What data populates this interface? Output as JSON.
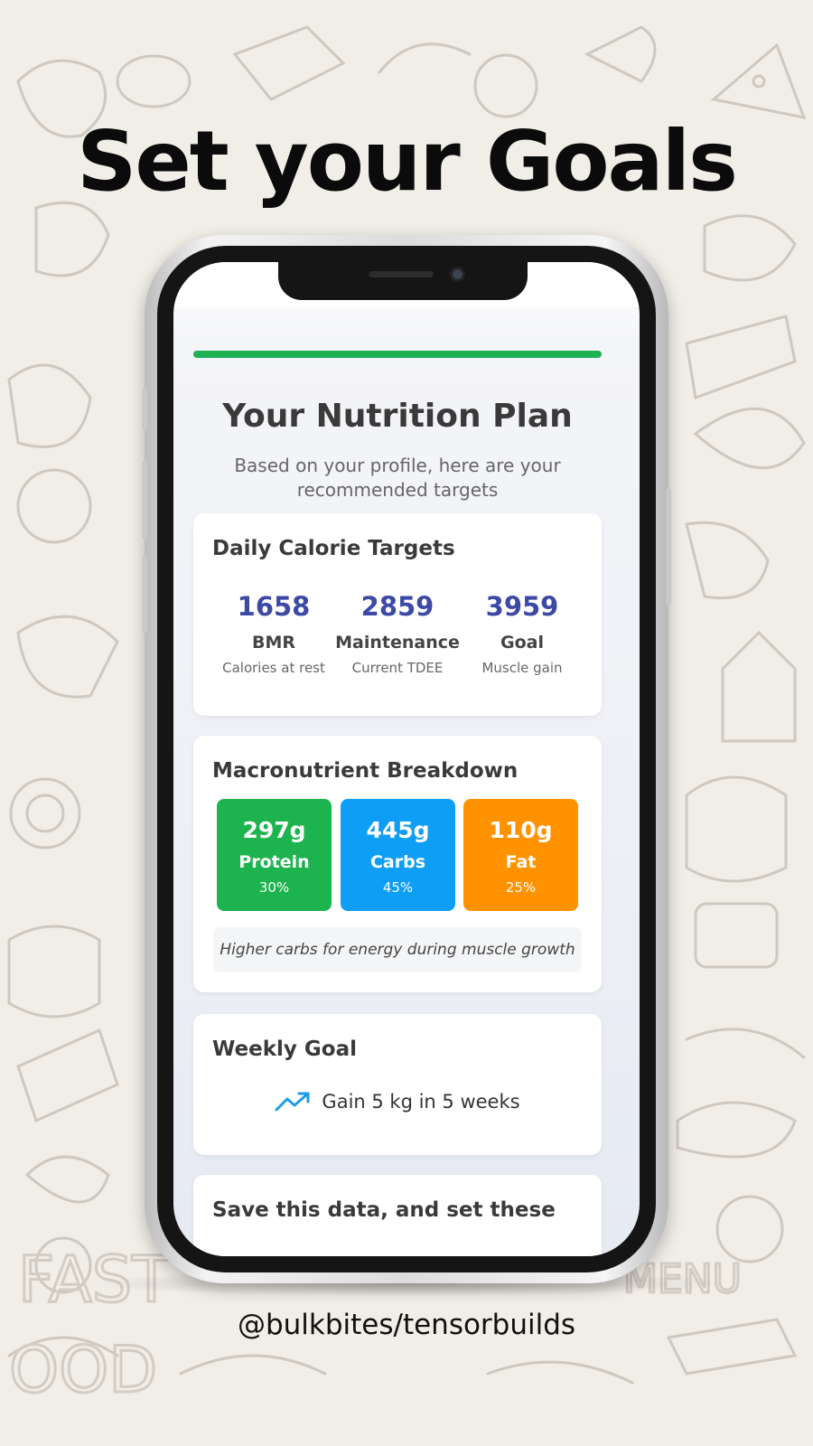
{
  "headline": "Set your Goals",
  "handle": "@bulkbites/tensorbuilds",
  "colors": {
    "background": "#f1ede7",
    "progress": "#1fb254",
    "calorie_value": "#3d4aa5",
    "protein": "#1db34e",
    "carbs": "#0f9ef5",
    "fat": "#ff9200"
  },
  "app": {
    "progress_fraction": 1.0,
    "title": "Your Nutrition Plan",
    "subtitle": "Based on your profile, here are your recommended targets",
    "calorie_card": {
      "title": "Daily Calorie Targets",
      "items": [
        {
          "value": "1658",
          "label": "BMR",
          "note": "Calories at rest"
        },
        {
          "value": "2859",
          "label": "Maintenance",
          "note": "Current TDEE"
        },
        {
          "value": "3959",
          "label": "Goal",
          "note": "Muscle gain"
        }
      ]
    },
    "macro_card": {
      "title": "Macronutrient Breakdown",
      "items": [
        {
          "grams": "297g",
          "name": "Protein",
          "percent": "30%"
        },
        {
          "grams": "445g",
          "name": "Carbs",
          "percent": "45%"
        },
        {
          "grams": "110g",
          "name": "Fat",
          "percent": "25%"
        }
      ],
      "note": "Higher carbs for energy during muscle growth"
    },
    "weekly_card": {
      "title": "Weekly Goal",
      "icon": "trending-up-icon",
      "text": "Gain 5 kg in 5 weeks"
    },
    "save_card": {
      "title": "Save this data, and set these"
    }
  }
}
